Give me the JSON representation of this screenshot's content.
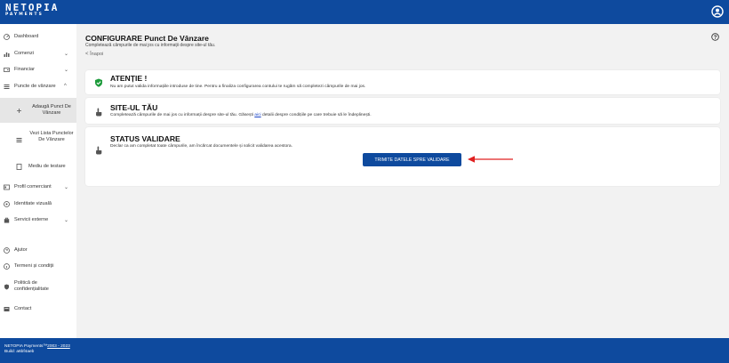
{
  "brand": {
    "logo_main": "NETOPIA",
    "logo_sub": "PAYMENTS"
  },
  "sidebar": {
    "items": [
      {
        "label": "Dashboard",
        "icon": "dashboard-icon"
      },
      {
        "label": "Comenzi",
        "icon": "chart-icon",
        "chevron": "⌄"
      },
      {
        "label": "Financiar",
        "icon": "wallet-icon",
        "chevron": "⌄"
      },
      {
        "label": "Puncte de vânzare",
        "icon": "list-icon",
        "chevron": "^"
      },
      {
        "label": "Adaugă Punct De Vânzare",
        "icon": "plus-icon"
      },
      {
        "label": "Vezi Lista Punctelor De Vânzare",
        "icon": "list-icon"
      },
      {
        "label": "Mediu de testare",
        "icon": "test-icon"
      },
      {
        "label": "Profil comerciant",
        "icon": "profile-icon",
        "chevron": "⌄"
      },
      {
        "label": "Identitate vizuală",
        "icon": "palette-icon"
      },
      {
        "label": "Servicii externe",
        "icon": "bag-icon",
        "chevron": "⌄"
      },
      {
        "label": "Ajutor",
        "icon": "help-icon"
      },
      {
        "label": "Termeni și condiții",
        "icon": "info-icon"
      },
      {
        "label": "Politică de confidențialitate",
        "icon": "shield-icon"
      },
      {
        "label": "Contact",
        "icon": "contact-icon"
      }
    ]
  },
  "header": {
    "title": "CONFIGURARE Punct De Vânzare",
    "subtitle": "Completează câmpurile de mai jos cu informații despre site-ul tău.",
    "back": "Înapoi"
  },
  "cards": {
    "attention": {
      "title": "ATENȚIE !",
      "text": "Nu am putut valida informațiile introduse de tine. Pentru a finaliza configurarea contului te rugăm să completezi câmpurile de mai jos."
    },
    "site": {
      "title": "SITE-UL TĂU",
      "text_before": "Completează câmpurile de mai jos cu informații despre site-ul tău. Găsești ",
      "link": "aici",
      "text_after": " detalii despre condițiile pe care trebuie să le îndeplinești."
    },
    "status": {
      "title": "STATUS VALIDARE",
      "text": "Declar ca am completat toate câmpurile, am încărcat documentele și solicit validarea acestora.",
      "button": "TRIMITE DATELE SPRE VALIDARE"
    }
  },
  "footer": {
    "company": "NETOPIA Payments™",
    "years": "2003 - 2023",
    "build": "Build: a6bf4aeb"
  },
  "colors": {
    "primary": "#0e4a9e",
    "success": "#1d9b3b",
    "arrow": "#e02020"
  }
}
